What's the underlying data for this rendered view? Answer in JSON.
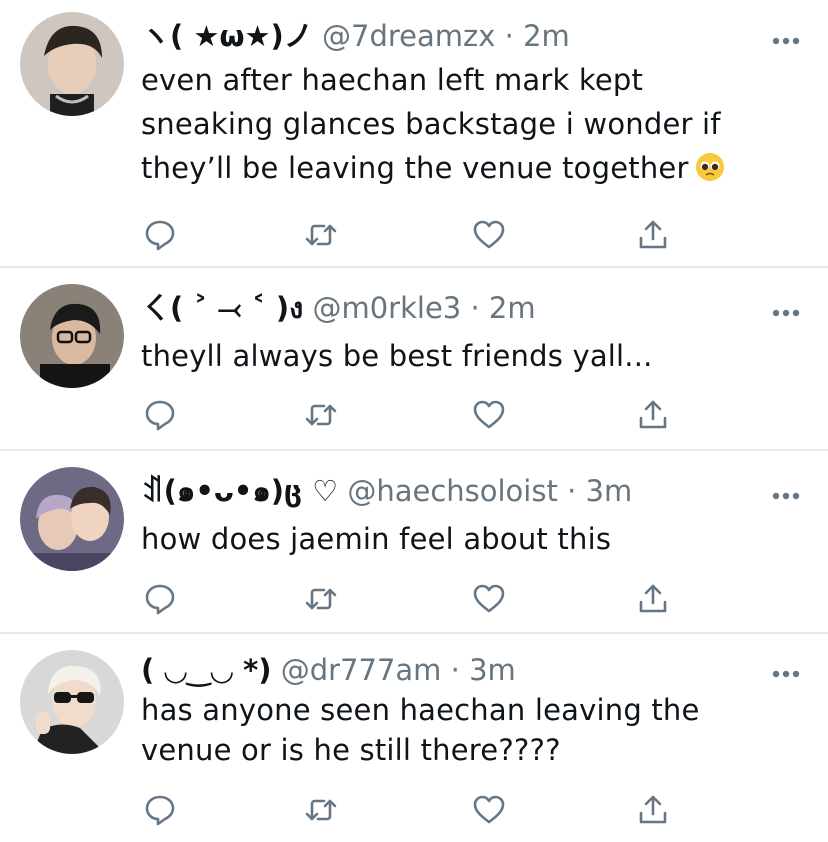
{
  "tweets": [
    {
      "display_name": "ヽ( ★ω★)ノ",
      "handle": "@7dreamzx",
      "separator": "·",
      "time": "2m",
      "text": "even after haechan left mark kept sneaking glances backstage i wonder if they’ll be leaving the venue together",
      "emoji": "pleading-face",
      "avatar_colors": [
        "#cfc7bf",
        "#2b2520"
      ]
    },
    {
      "display_name": "ㄑ( ˃ ⤙ ˂ )ง",
      "handle": "@m0rkle3",
      "separator": "·",
      "time": "2m",
      "text": "theyll always be best friends yall...",
      "avatar_colors": [
        "#8a8178",
        "#1a1a1a"
      ]
    },
    {
      "display_name": "ꀊ(๑•ᴗ•๑)ც ♡",
      "handle": "@haechsoloist",
      "separator": "·",
      "time": "3m",
      "text": "how does jaemin feel about this",
      "avatar_colors": [
        "#6e6a86",
        "#e0c9b8"
      ]
    },
    {
      "display_name": "( ◡‿◡ *)",
      "handle": "@dr777am",
      "separator": "·",
      "time": "3m",
      "text": "has anyone seen haechan leaving the venue or is he still there????",
      "avatar_colors": [
        "#d8d8d8",
        "#222222"
      ]
    }
  ],
  "icons": {
    "reply": "reply-icon",
    "retweet": "retweet-icon",
    "like": "like-icon",
    "share": "share-icon",
    "more": "more-icon"
  },
  "colors": {
    "icon_gray": "#657786",
    "divider": "#e6e9ec",
    "secondary_text": "#66757f",
    "primary_text": "#0f1419"
  }
}
